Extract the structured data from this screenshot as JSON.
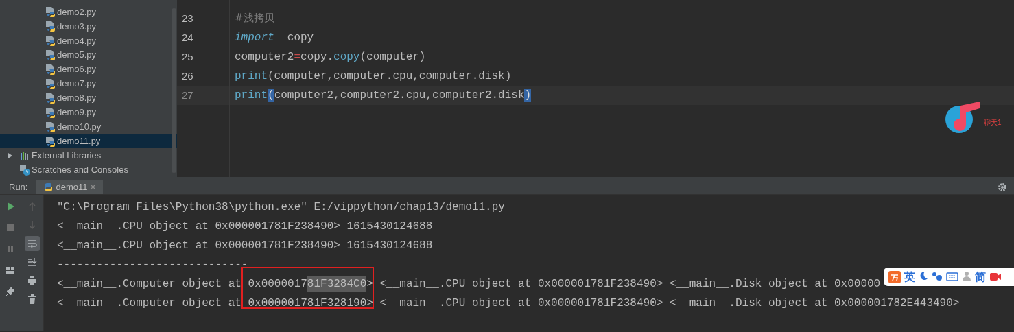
{
  "project_tree": {
    "items": [
      {
        "label": "demo2.py",
        "kind": "python",
        "selected": false
      },
      {
        "label": "demo3.py",
        "kind": "python",
        "selected": false
      },
      {
        "label": "demo4.py",
        "kind": "python",
        "selected": false
      },
      {
        "label": "demo5.py",
        "kind": "python",
        "selected": false
      },
      {
        "label": "demo6.py",
        "kind": "python",
        "selected": false
      },
      {
        "label": "demo7.py",
        "kind": "python",
        "selected": false
      },
      {
        "label": "demo8.py",
        "kind": "python",
        "selected": false
      },
      {
        "label": "demo9.py",
        "kind": "python",
        "selected": false
      },
      {
        "label": "demo10.py",
        "kind": "python",
        "selected": false
      },
      {
        "label": "demo11.py",
        "kind": "python",
        "selected": true
      },
      {
        "label": "External Libraries",
        "kind": "libraries",
        "selected": false,
        "expanded": false
      },
      {
        "label": "Scratches and Consoles",
        "kind": "scratches",
        "selected": false
      }
    ]
  },
  "editor": {
    "lines": [
      {
        "number": "23",
        "current": false,
        "tokens": [
          {
            "kind": "comment",
            "text": "#浅拷贝"
          }
        ]
      },
      {
        "number": "24",
        "current": false,
        "tokens": [
          {
            "kind": "keyword",
            "text": "import"
          },
          {
            "kind": "plain",
            "text": "  copy"
          }
        ]
      },
      {
        "number": "25",
        "current": false,
        "tokens": [
          {
            "kind": "plain",
            "text": "computer2"
          },
          {
            "kind": "op",
            "text": "="
          },
          {
            "kind": "plain",
            "text": "copy."
          },
          {
            "kind": "call",
            "text": "copy"
          },
          {
            "kind": "plain",
            "text": "(computer)"
          }
        ]
      },
      {
        "number": "26",
        "current": false,
        "tokens": [
          {
            "kind": "call",
            "text": "print"
          },
          {
            "kind": "plain",
            "text": "(computer,computer.cpu,computer.disk)"
          }
        ]
      },
      {
        "number": "27",
        "current": true,
        "tokens": [
          {
            "kind": "call",
            "text": "print"
          },
          {
            "kind": "brace",
            "text": "("
          },
          {
            "kind": "plain",
            "text": "computer2,computer2.cpu,computer2.disk"
          },
          {
            "kind": "brace",
            "text": ")"
          }
        ]
      }
    ]
  },
  "overlay_app": {
    "caption": "聊天1"
  },
  "run_panel": {
    "label": "Run:",
    "tabs": [
      {
        "label": "demo11",
        "selected": true
      }
    ],
    "tools": [
      {
        "kind": "run",
        "selected": false
      },
      {
        "kind": "stop",
        "selected": false
      },
      {
        "kind": "pause",
        "selected": false
      },
      {
        "kind": "layout",
        "selected": false
      },
      {
        "kind": "pin",
        "selected": false
      }
    ],
    "tools_2": [
      {
        "kind": "up",
        "selected": false
      },
      {
        "kind": "down",
        "selected": false
      },
      {
        "kind": "wrap",
        "selected": true
      },
      {
        "kind": "scroll_end",
        "selected": false
      },
      {
        "kind": "print",
        "selected": false
      },
      {
        "kind": "trash",
        "selected": false
      }
    ],
    "console": [
      [
        {
          "text": "\"C:\\Program Files\\Python38\\python.exe\" E:/vippython/chap13/demo11.py",
          "selected": false
        }
      ],
      [
        {
          "text": "<__main__.CPU object at 0x000001781F238490> 1615430124688",
          "selected": false
        }
      ],
      [
        {
          "text": "<__main__.CPU object at 0x000001781F238490> 1615430124688",
          "selected": false
        }
      ],
      [
        {
          "text": "-----------------------------",
          "selected": false
        }
      ],
      [
        {
          "text": "<__main__.Computer object at 0x0000017",
          "selected": false
        },
        {
          "text": "81F3284C0",
          "selected": true
        },
        {
          "text": "> <__main__.CPU object at 0x000001781F238490> <__main__.Disk object at 0x00000",
          "selected": false
        }
      ],
      [
        {
          "text": "<__main__.Computer object at 0x000001781F328190> <__main__.CPU object at 0x000001781F238490> <__main__.Disk object at 0x000001782E443490>",
          "selected": false
        }
      ]
    ]
  },
  "ime_toolbar": {
    "items": [
      {
        "kind": "logo"
      },
      {
        "kind": "text",
        "text": "英"
      },
      {
        "kind": "moon"
      },
      {
        "kind": "dots"
      },
      {
        "kind": "keyboard"
      },
      {
        "kind": "person"
      },
      {
        "kind": "text",
        "text": "简"
      },
      {
        "kind": "video"
      }
    ]
  }
}
